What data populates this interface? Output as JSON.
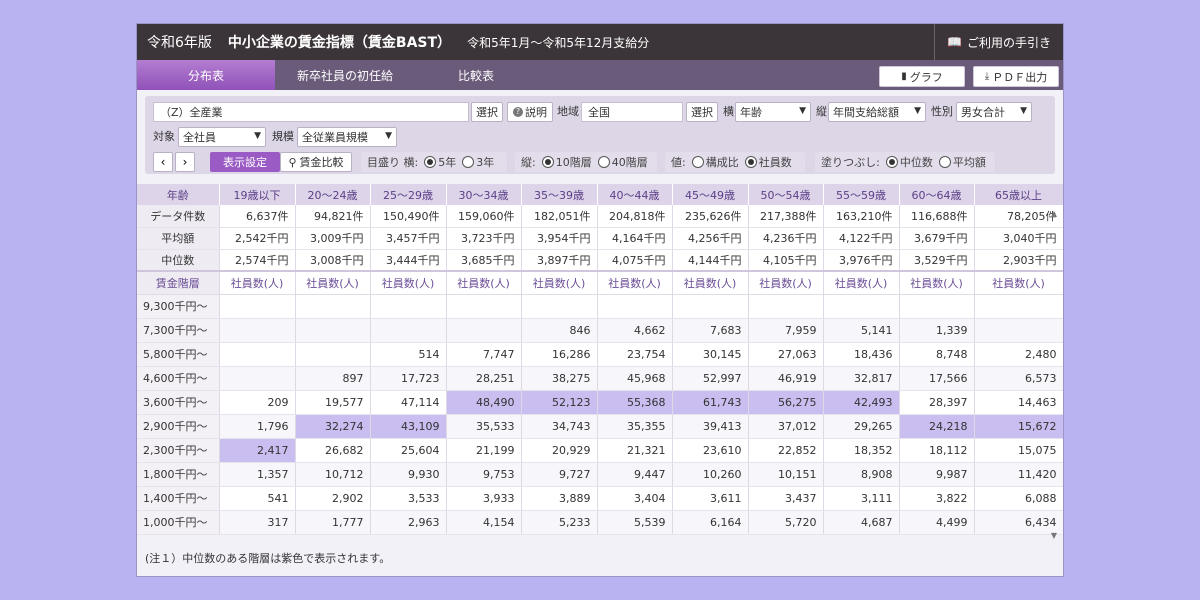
{
  "header": {
    "edition": "令和6年版",
    "title": "中小企業の賃金指標（賃金BAST）",
    "period": "令和5年1月～令和5年12月支給分",
    "guide_label": "ご利用の手引き"
  },
  "tabs": [
    {
      "label": "分布表",
      "active": true
    },
    {
      "label": "新卒社員の初任給",
      "active": false
    },
    {
      "label": "比較表",
      "active": false
    }
  ],
  "actions": {
    "graph_label": "グラフ",
    "pdf_label": "ＰＤＦ出力"
  },
  "filters": {
    "industry_value": "（Z）全産業",
    "select_label": "選択",
    "explain_label": "説明",
    "region_label": "地域",
    "region_value": "全国",
    "horizontal_label": "横",
    "horizontal_value": "年齢",
    "vertical_label": "縦",
    "vertical_value": "年間支給総額",
    "gender_label": "性別",
    "gender_value": "男女合計",
    "target_label": "対象",
    "target_value": "全社員",
    "scale_label": "規模",
    "scale_value": "全従業員規模"
  },
  "controls": {
    "display_settings": "表示設定",
    "wage_compare": "賃金比較",
    "scale_group_label": "目盛り 横:",
    "scale_5": "5年",
    "scale_3": "3年",
    "vertical_group_label": "縦:",
    "vert_10": "10階層",
    "vert_40": "40階層",
    "value_group_label": "値:",
    "value_ratio": "構成比",
    "value_count": "社員数",
    "fill_group_label": "塗りつぶし:",
    "fill_median": "中位数",
    "fill_mean": "平均額"
  },
  "table": {
    "corner": "年齢",
    "columns": [
      "19歳以下",
      "20～24歳",
      "25～29歳",
      "30～34歳",
      "35～39歳",
      "40～44歳",
      "45～49歳",
      "50～54歳",
      "55～59歳",
      "60～64歳",
      "65歳以上"
    ],
    "stats": [
      {
        "label": "データ件数",
        "values": [
          "6,637件",
          "94,821件",
          "150,490件",
          "159,060件",
          "182,051件",
          "204,818件",
          "235,626件",
          "217,388件",
          "163,210件",
          "116,688件",
          "78,205件"
        ]
      },
      {
        "label": "平均額",
        "values": [
          "2,542千円",
          "3,009千円",
          "3,457千円",
          "3,723千円",
          "3,954千円",
          "4,164千円",
          "4,256千円",
          "4,236千円",
          "4,122千円",
          "3,679千円",
          "3,040千円"
        ]
      },
      {
        "label": "中位数",
        "values": [
          "2,574千円",
          "3,008千円",
          "3,444千円",
          "3,685千円",
          "3,897千円",
          "4,075千円",
          "4,144千円",
          "4,105千円",
          "3,976千円",
          "3,529千円",
          "2,903千円"
        ]
      }
    ],
    "sub_corner": "賃金階層",
    "sub_header": "社員数(人)",
    "rows": [
      {
        "label": "9,300千円～",
        "values": [
          "",
          "",
          "",
          "",
          "",
          "",
          "",
          "",
          "",
          "",
          ""
        ]
      },
      {
        "label": "7,300千円～",
        "values": [
          "",
          "",
          "",
          "",
          "846",
          "4,662",
          "7,683",
          "7,959",
          "5,141",
          "1,339",
          ""
        ]
      },
      {
        "label": "5,800千円～",
        "values": [
          "",
          "",
          "514",
          "7,747",
          "16,286",
          "23,754",
          "30,145",
          "27,063",
          "18,436",
          "8,748",
          "2,480"
        ]
      },
      {
        "label": "4,600千円～",
        "values": [
          "",
          "897",
          "17,723",
          "28,251",
          "38,275",
          "45,968",
          "52,997",
          "46,919",
          "32,817",
          "17,566",
          "6,573"
        ]
      },
      {
        "label": "3,600千円～",
        "values": [
          "209",
          "19,577",
          "47,114",
          "48,490",
          "52,123",
          "55,368",
          "61,743",
          "56,275",
          "42,493",
          "28,397",
          "14,463"
        ]
      },
      {
        "label": "2,900千円～",
        "values": [
          "1,796",
          "32,274",
          "43,109",
          "35,533",
          "34,743",
          "35,355",
          "39,413",
          "37,012",
          "29,265",
          "24,218",
          "15,672"
        ]
      },
      {
        "label": "2,300千円～",
        "values": [
          "2,417",
          "26,682",
          "25,604",
          "21,199",
          "20,929",
          "21,321",
          "23,610",
          "22,852",
          "18,352",
          "18,112",
          "15,075"
        ]
      },
      {
        "label": "1,800千円～",
        "values": [
          "1,357",
          "10,712",
          "9,930",
          "9,753",
          "9,727",
          "9,447",
          "10,260",
          "10,151",
          "8,908",
          "9,987",
          "11,420"
        ]
      },
      {
        "label": "1,400千円～",
        "values": [
          "541",
          "2,902",
          "3,533",
          "3,933",
          "3,889",
          "3,404",
          "3,611",
          "3,437",
          "3,111",
          "3,822",
          "6,088"
        ]
      },
      {
        "label": "1,000千円～",
        "values": [
          "317",
          "1,777",
          "2,963",
          "4,154",
          "5,233",
          "5,539",
          "6,164",
          "5,720",
          "4,687",
          "4,499",
          "6,434"
        ]
      }
    ],
    "highlight_row_per_column": [
      6,
      5,
      5,
      4,
      4,
      4,
      4,
      4,
      4,
      5,
      5
    ]
  },
  "note": "(注１）中位数のある階層は紫色で表示されます。",
  "colors": {
    "accent": "#9052b8",
    "highlight": "#cabdf0",
    "titlebar": "#3b3438"
  }
}
